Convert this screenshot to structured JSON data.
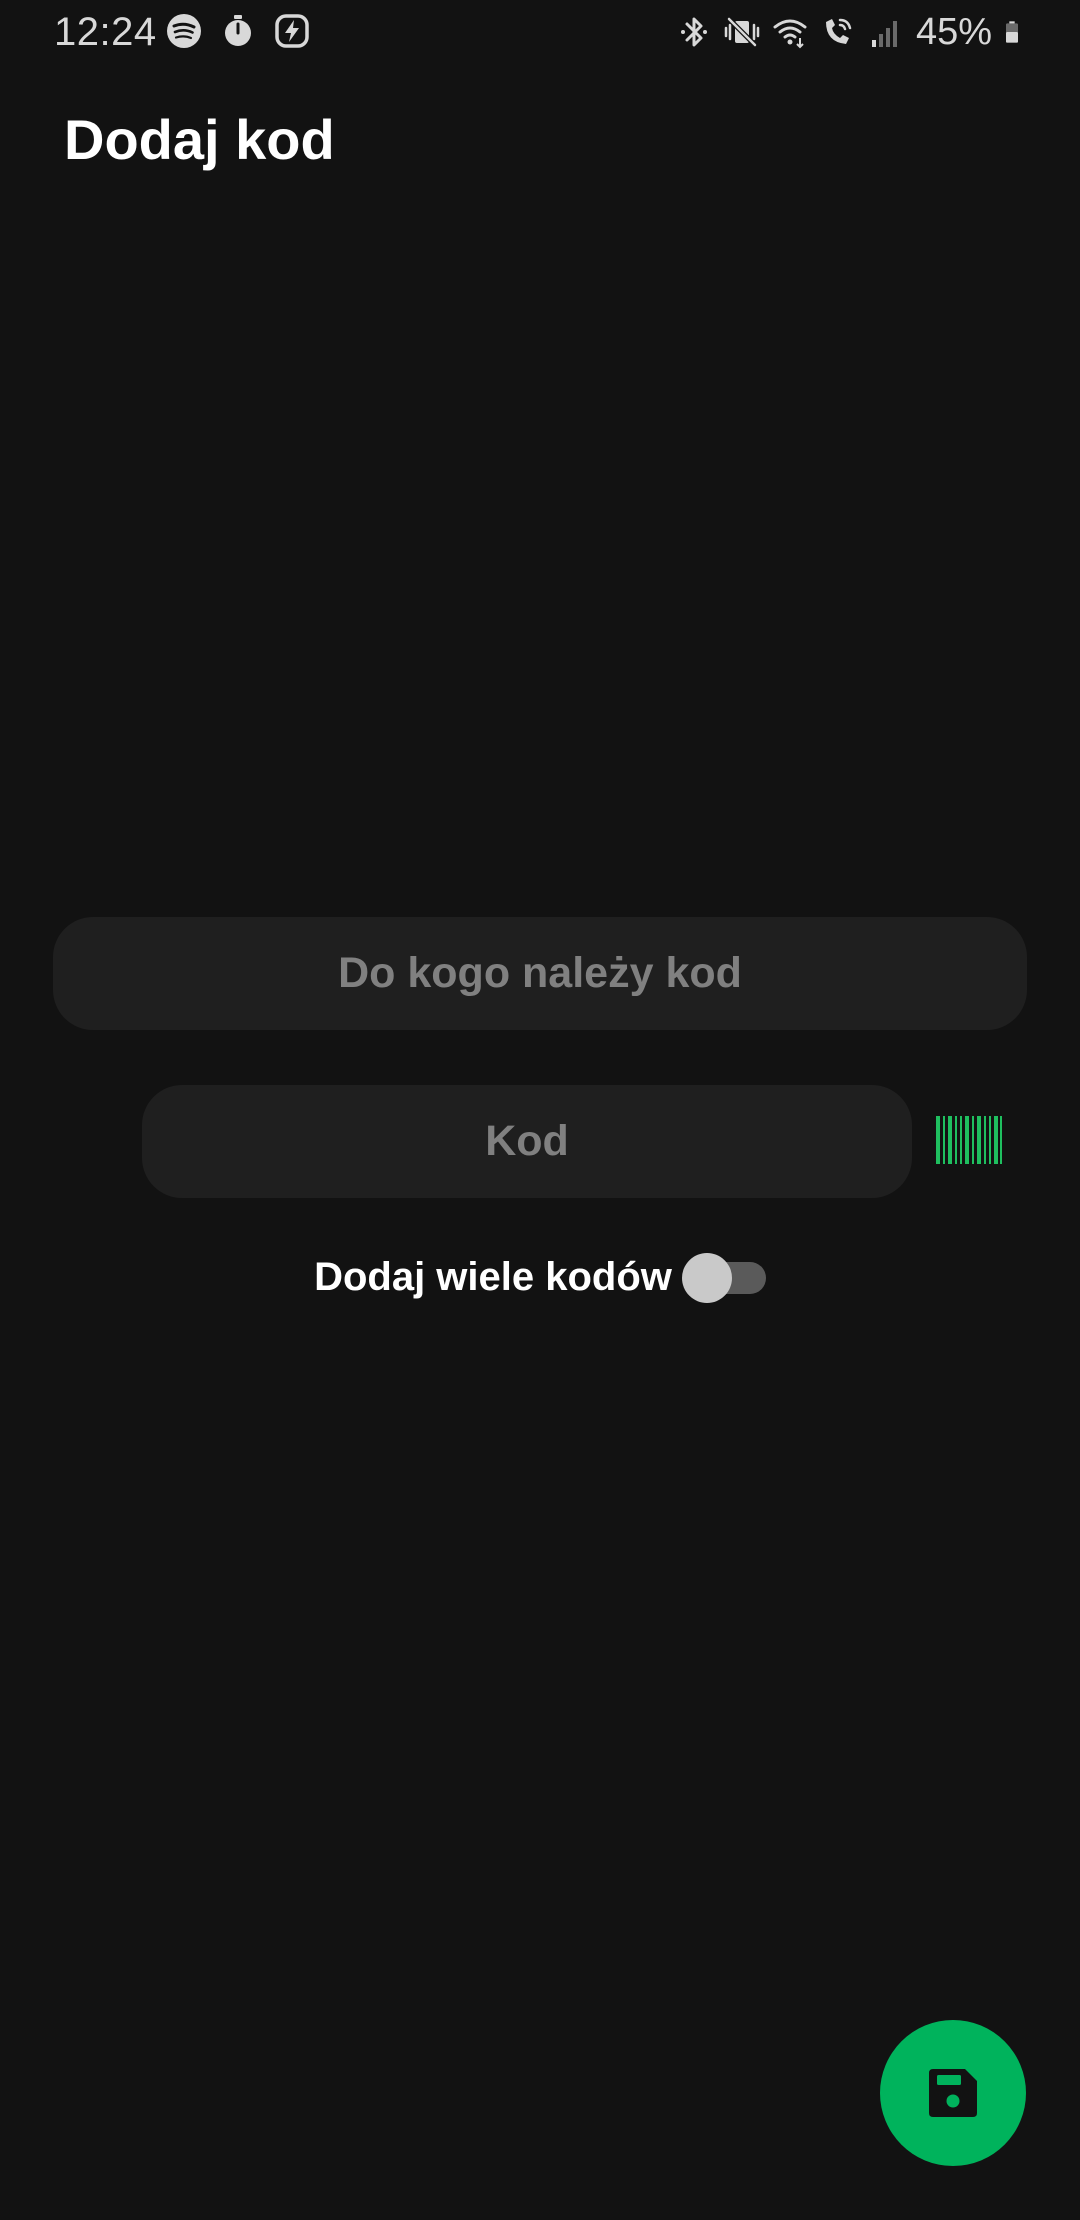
{
  "status_bar": {
    "time": "12:24",
    "battery_percent": "45%",
    "left_icons": [
      "spotify-icon",
      "stopwatch-icon",
      "charging-bolt-icon"
    ],
    "right_icons": [
      "bluetooth-icon",
      "vibrate-mute-icon",
      "wifi-icon",
      "wifi-calling-icon",
      "signal-icon",
      "battery-icon"
    ]
  },
  "header": {
    "title": "Dodaj kod"
  },
  "form": {
    "owner_field": {
      "placeholder": "Do kogo należy kod",
      "value": ""
    },
    "code_field": {
      "placeholder": "Kod",
      "value": ""
    },
    "scan_button_icon": "barcode-icon",
    "multi_toggle": {
      "label": "Dodaj wiele kodów",
      "checked": false
    }
  },
  "fab": {
    "icon": "save-icon"
  },
  "colors": {
    "background": "#121212",
    "field_background": "#1f1f1f",
    "placeholder": "#808080",
    "accent": "#00b35c",
    "barcode": "#1fbf5f"
  }
}
